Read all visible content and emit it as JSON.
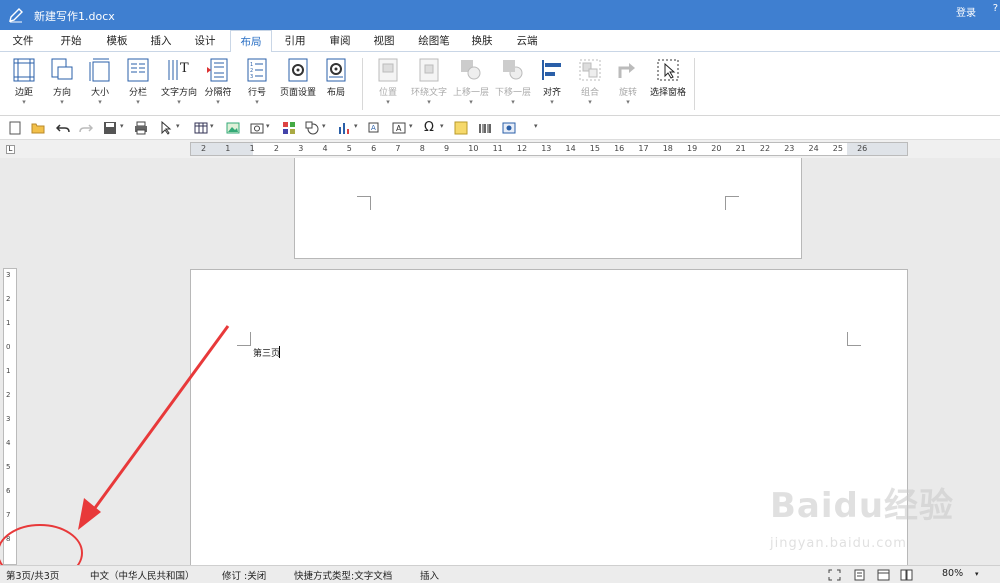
{
  "window": {
    "title": "新建写作1.docx",
    "login": "登录",
    "help": "?"
  },
  "tabs": [
    {
      "label": "文件"
    },
    {
      "label": "开始"
    },
    {
      "label": "模板"
    },
    {
      "label": "插入"
    },
    {
      "label": "设计"
    },
    {
      "label": "布局"
    },
    {
      "label": "引用"
    },
    {
      "label": "审阅"
    },
    {
      "label": "视图"
    },
    {
      "label": "绘图笔"
    },
    {
      "label": "换肤"
    },
    {
      "label": "云端"
    }
  ],
  "active_tab": "布局",
  "ribbon": {
    "margins": "边距",
    "orientation": "方向",
    "size": "大小",
    "columns": "分栏",
    "text_direction": "文字方向",
    "breaks": "分隔符",
    "line_numbers": "行号",
    "page_setup": "页面设置",
    "layout": "布局",
    "position": "位置",
    "wrap_text": "环绕文字",
    "bring_forward": "上移一层",
    "send_backward": "下移一层",
    "align": "对齐",
    "group": "组合",
    "rotate": "旋转",
    "selection_pane": "选择窗格"
  },
  "ruler": {
    "h_numbers": [
      "2",
      "1",
      "1",
      "2",
      "3",
      "4",
      "5",
      "6",
      "7",
      "8",
      "9",
      "10",
      "11",
      "12",
      "13",
      "14",
      "15",
      "16",
      "17",
      "18",
      "19",
      "20",
      "21",
      "22",
      "23",
      "24",
      "25",
      "26"
    ],
    "v_numbers": [
      "3",
      "2",
      "1",
      "0",
      "1",
      "2",
      "3",
      "4",
      "5",
      "6",
      "7",
      "8"
    ],
    "tab_stop": "L"
  },
  "document": {
    "page_text": "第三页"
  },
  "status": {
    "page": "第3页/共3页",
    "language": "中文（中华人民共和国）",
    "track_changes": "修订 :关闭",
    "shortcut_type": "快捷方式类型:文字文档",
    "insert_mode": "插入",
    "zoom": "80%"
  },
  "watermark": {
    "logo": "Baidu经验",
    "url": "jingyan.baidu.com"
  },
  "colors": {
    "titlebar": "#3f7fd0",
    "accent": "#2a6fc4",
    "annotation": "#e8393a"
  }
}
